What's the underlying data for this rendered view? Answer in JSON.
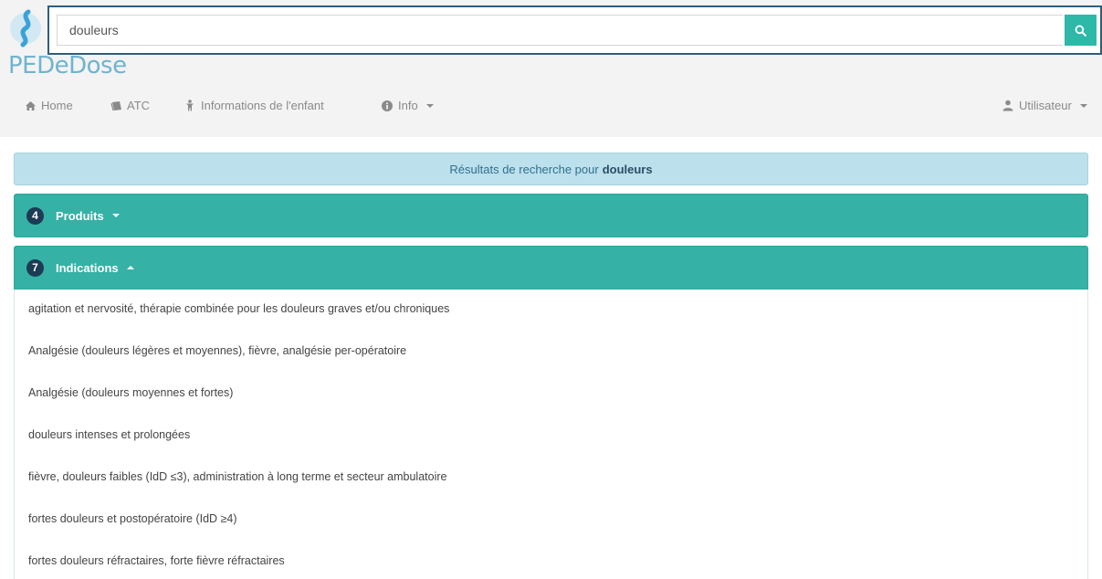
{
  "brand": {
    "name": "PEDeDose"
  },
  "search": {
    "value": "douleurs",
    "button_icon": "search-icon"
  },
  "nav": {
    "home": "Home",
    "atc": "ATC",
    "child_info": "Informations de l'enfant",
    "info": "Info",
    "user": "Utilisateur"
  },
  "results": {
    "prefix": "Résultats de recherche pour",
    "term": "douleurs"
  },
  "panels": {
    "produits": {
      "count": "4",
      "title": "Produits"
    },
    "indications": {
      "count": "7",
      "title": "Indications",
      "items": [
        "agitation et nervosité, thérapie combinée pour les douleurs graves et/ou chroniques",
        "Analgésie (douleurs légères et moyennes), fièvre, analgésie per-opératoire",
        "Analgésie (douleurs moyennes et fortes)",
        "douleurs intenses et prolongées",
        "fièvre, douleurs faibles (IdD ≤3), administration à long terme et secteur ambulatoire",
        "fortes douleurs et postopératoire (IdD ≥4)",
        "fortes douleurs réfractaires, forte fièvre réfractaires"
      ]
    }
  },
  "colors": {
    "accent": "#35b1a5",
    "banner": "#bce0ec",
    "badge": "#1c3b55",
    "logo": "#6fb4cf"
  }
}
